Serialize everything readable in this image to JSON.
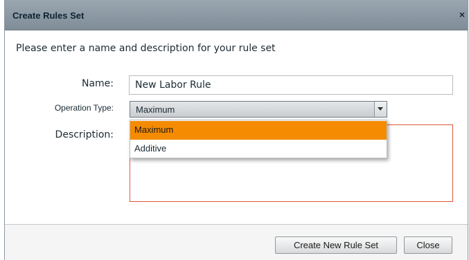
{
  "dialog": {
    "title": "Create Rules Set",
    "close_glyph": "×",
    "intro": "Please enter a name and description for your rule set"
  },
  "form": {
    "name_label": "Name:",
    "name_value": "New Labor Rule",
    "operation_label": "Operation Type:",
    "operation_selected": "Maximum",
    "operation_options": [
      "Maximum",
      "Additive"
    ],
    "highlighted_option": "Maximum",
    "description_label": "Description:",
    "description_value": ""
  },
  "footer": {
    "create_label": "Create New Rule Set",
    "close_label": "Close"
  },
  "colors": {
    "highlight": "#f48b00",
    "titlebar": "#8a97a2",
    "description_border": "#e0553a"
  },
  "icons": {
    "close": "close-icon",
    "dropdown": "chevron-down-icon"
  }
}
